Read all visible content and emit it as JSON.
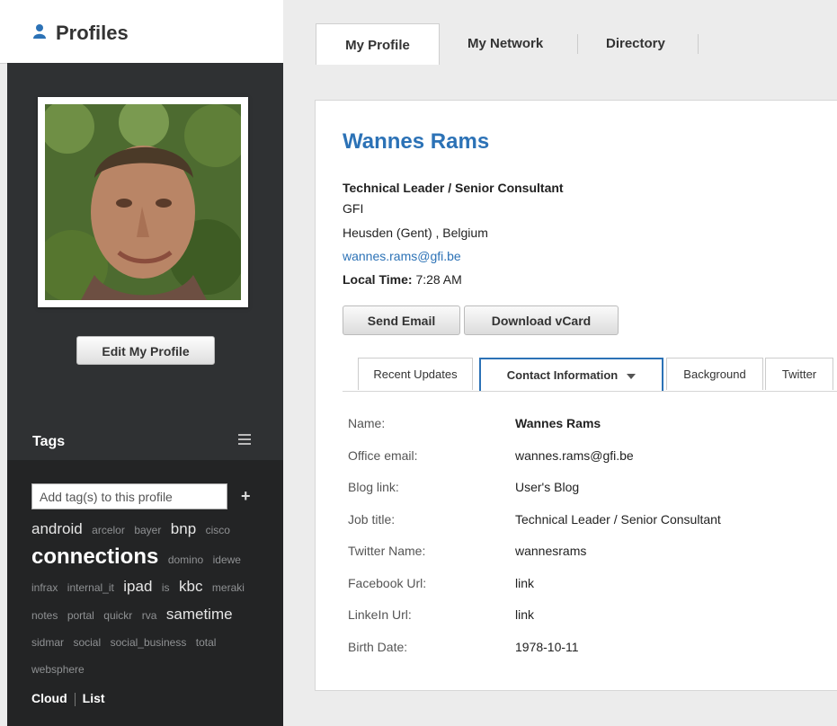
{
  "app": {
    "title": "Profiles"
  },
  "nav": {
    "tabs": [
      "My Profile",
      "My Network",
      "Directory"
    ],
    "active": "My Profile"
  },
  "sidebar": {
    "edit_button": "Edit My Profile",
    "tags_title": "Tags",
    "tag_input_placeholder": "Add tag(s) to this profile",
    "tag_add": "+",
    "tags": [
      {
        "text": "android",
        "weight": 3
      },
      {
        "text": "arcelor",
        "weight": 1
      },
      {
        "text": "bayer",
        "weight": 1
      },
      {
        "text": "bnp",
        "weight": 3
      },
      {
        "text": "cisco",
        "weight": 1
      },
      {
        "text": "connections",
        "weight": 4
      },
      {
        "text": "domino",
        "weight": 1
      },
      {
        "text": "idewe",
        "weight": 1
      },
      {
        "text": "infrax",
        "weight": 1
      },
      {
        "text": "internal_it",
        "weight": 1
      },
      {
        "text": "ipad",
        "weight": 3
      },
      {
        "text": "is",
        "weight": 1
      },
      {
        "text": "kbc",
        "weight": 3
      },
      {
        "text": "meraki",
        "weight": 1
      },
      {
        "text": "notes",
        "weight": 1
      },
      {
        "text": "portal",
        "weight": 1
      },
      {
        "text": "quickr",
        "weight": 1
      },
      {
        "text": "rva",
        "weight": 1
      },
      {
        "text": "sametime",
        "weight": 3
      },
      {
        "text": "sidmar",
        "weight": 1
      },
      {
        "text": "social",
        "weight": 1
      },
      {
        "text": "social_business",
        "weight": 1
      },
      {
        "text": "total",
        "weight": 1
      },
      {
        "text": "websphere",
        "weight": 1
      }
    ],
    "view_cloud": "Cloud",
    "view_list": "List"
  },
  "profile": {
    "name": "Wannes Rams",
    "job_title": "Technical Leader / Senior Consultant",
    "organization": "GFI",
    "location": "Heusden (Gent) , Belgium",
    "email": "wannes.rams@gfi.be",
    "local_time_label": "Local Time:",
    "local_time": "7:28 AM",
    "send_email": "Send Email",
    "download_vcard": "Download vCard"
  },
  "subtabs": [
    {
      "label": "Recent Updates",
      "active": false
    },
    {
      "label": "Contact Information",
      "active": true
    },
    {
      "label": "Background",
      "active": false
    },
    {
      "label": "Twitter",
      "active": false
    }
  ],
  "contact": [
    {
      "label": "Name:",
      "value": "Wannes Rams",
      "style": "bold"
    },
    {
      "label": "Office email:",
      "value": "wannes.rams@gfi.be",
      "style": "link"
    },
    {
      "label": "Blog link:",
      "value": "User's Blog",
      "style": "link"
    },
    {
      "label": "Job title:",
      "value": "Technical Leader / Senior Consultant",
      "style": "plain"
    },
    {
      "label": "Twitter Name:",
      "value": "wannesrams",
      "style": "plain"
    },
    {
      "label": "Facebook Url:",
      "value": "link",
      "style": "link"
    },
    {
      "label": "LinkeIn Url:",
      "value": "link",
      "style": "link"
    },
    {
      "label": "Birth Date:",
      "value": "1978-10-11",
      "style": "plain"
    }
  ]
}
